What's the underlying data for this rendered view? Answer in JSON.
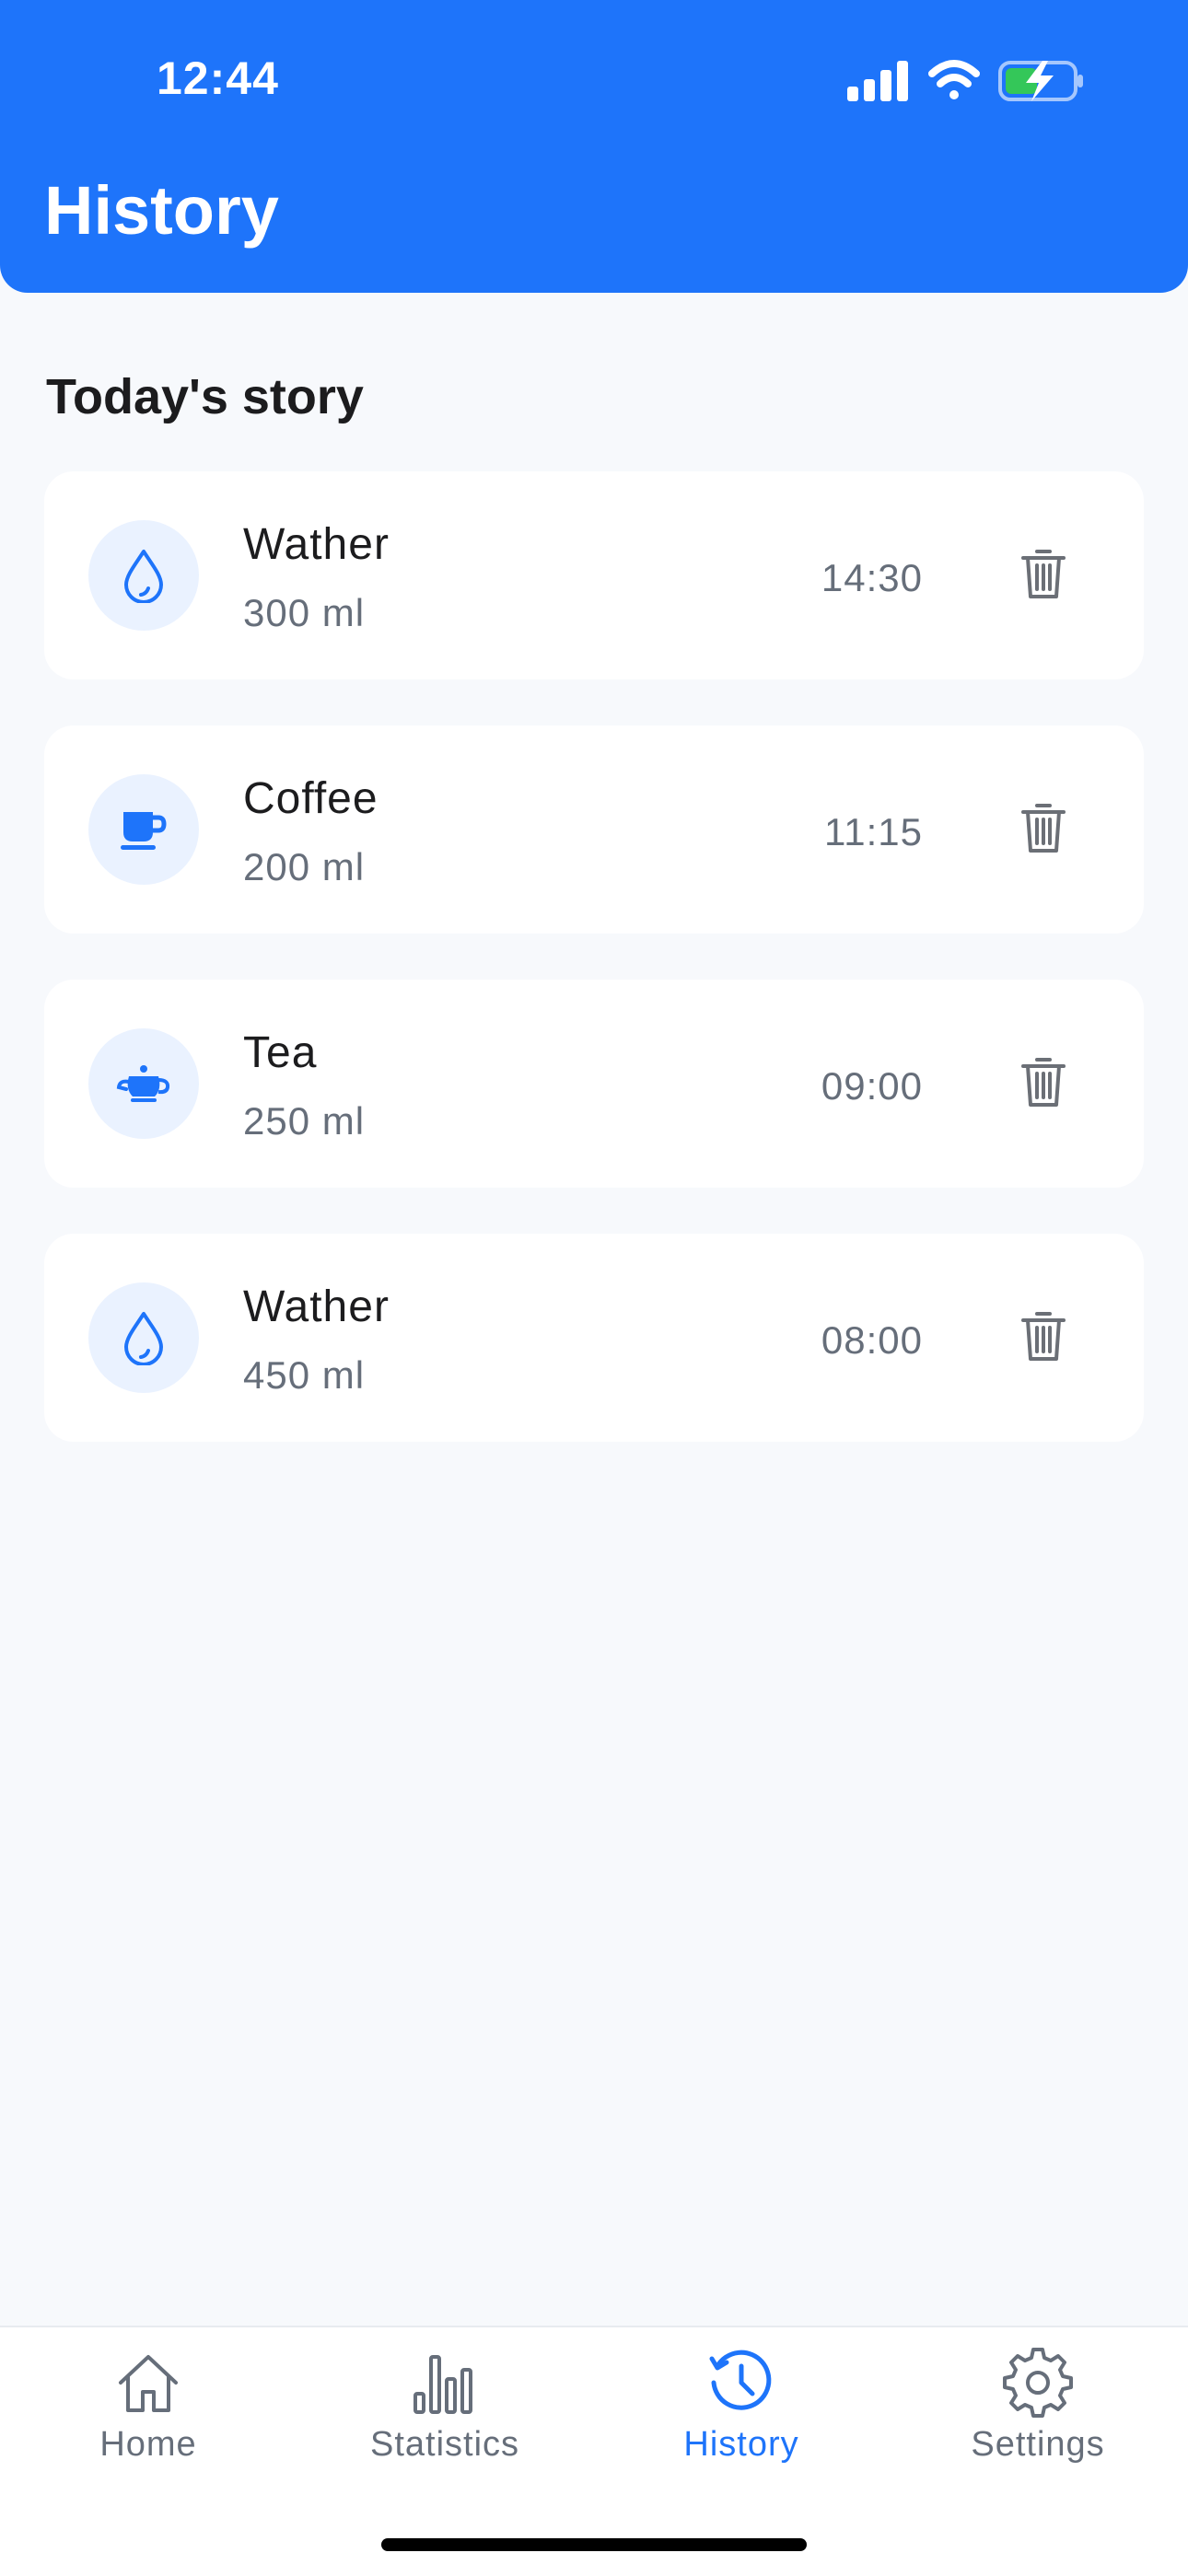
{
  "status_bar": {
    "time": "12:44",
    "icons": [
      "cellular-signal-icon",
      "wifi-icon",
      "battery-charging-icon"
    ]
  },
  "header": {
    "title": "History"
  },
  "section": {
    "title": "Today's story"
  },
  "entries": [
    {
      "name": "Wather",
      "amount": "300 ml",
      "time": "14:30",
      "icon": "water-drop-icon"
    },
    {
      "name": "Coffee",
      "amount": "200 ml",
      "time": "11:15",
      "icon": "coffee-cup-icon"
    },
    {
      "name": "Tea",
      "amount": "250 ml",
      "time": "09:00",
      "icon": "teapot-icon"
    },
    {
      "name": "Wather",
      "amount": "450 ml",
      "time": "08:00",
      "icon": "water-drop-icon"
    }
  ],
  "bottom_nav": {
    "items": [
      {
        "label": "Home",
        "icon": "home-icon",
        "active": false
      },
      {
        "label": "Statistics",
        "icon": "bar-chart-icon",
        "active": false
      },
      {
        "label": "History",
        "icon": "history-clock-icon",
        "active": true
      },
      {
        "label": "Settings",
        "icon": "gear-icon",
        "active": false
      }
    ]
  },
  "colors": {
    "accent": "#1E74FA",
    "background": "#F7F9FC",
    "card": "#FFFFFF",
    "icon_bg": "#EAF2FF",
    "text_primary": "#1C1C1E",
    "text_secondary": "#666E7A"
  }
}
